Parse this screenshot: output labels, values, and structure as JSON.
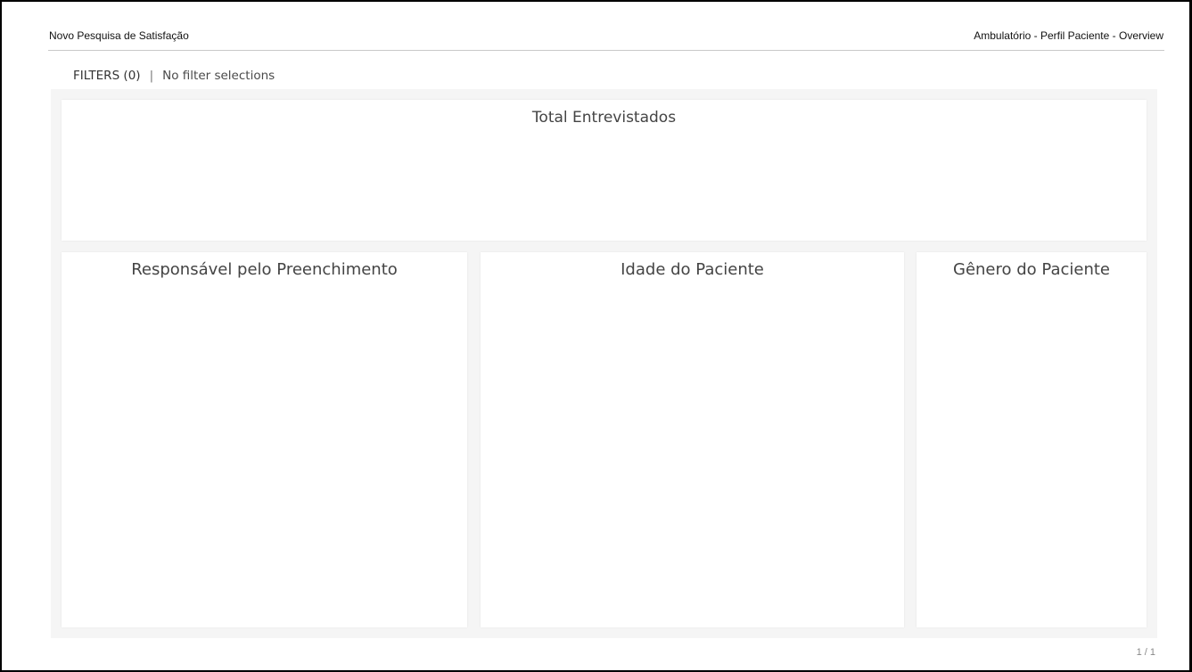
{
  "header": {
    "left_title": "Novo Pesquisa de Satisfação",
    "right_title": "Ambulatório - Perfil Paciente - Overview"
  },
  "filters": {
    "label": "FILTERS (0)",
    "separator": "|",
    "status": "No filter selections"
  },
  "cards": {
    "total": {
      "title": "Total Entrevistados"
    },
    "responsavel": {
      "title": "Responsável pelo Preenchimento"
    },
    "idade": {
      "title": "Idade do Paciente"
    },
    "genero": {
      "title": "Gênero do Paciente"
    }
  },
  "pager": {
    "text": "1 / 1"
  }
}
